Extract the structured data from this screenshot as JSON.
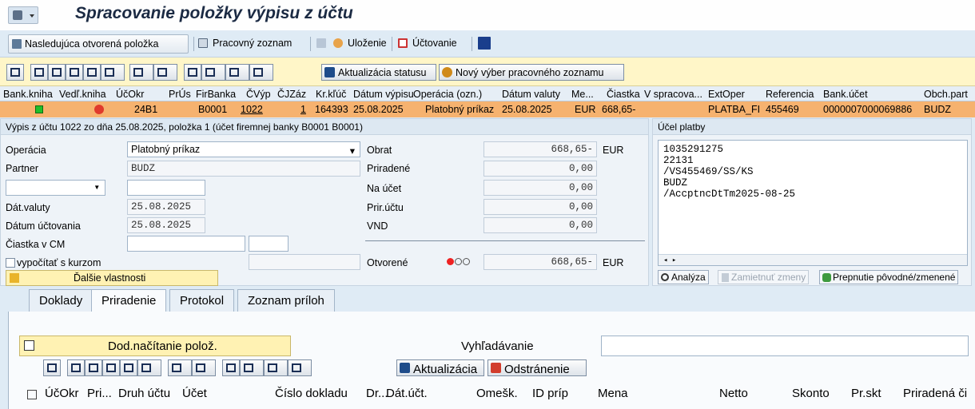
{
  "window": {
    "title": "Spracovanie položky výpisu z účtu"
  },
  "app_toolbar": {
    "next_open_item": "Nasledujúca otvorená položka",
    "worklist": "Pracovný zoznam",
    "save": "Uloženie",
    "posting": "Účtovanie"
  },
  "grid_toolbar": {
    "refresh_status": "Aktualizácia statusu",
    "new_worklist_selection": "Nový výber pracovného zoznamu"
  },
  "grid": {
    "headers": [
      "Bank.kniha",
      "Vedľ.kniha",
      "ÚčOkr",
      "PrÚs",
      "FirBanka",
      "ČVýp",
      "ČJZáz",
      "Kr.kľúč",
      "Dátum výpisu",
      "Operácia (ozn.)",
      "Dátum valuty",
      "Me...",
      "Čiastka",
      "V spracova...",
      "ExtOper",
      "Referencia",
      "Bank.účet",
      "Obch.part"
    ],
    "row": {
      "ucokr": "24B1",
      "firbanka": "B0001",
      "cvyp": "1022",
      "cjzaz": "1",
      "krkluc": "164393",
      "datum_vypisu": "25.08.2025",
      "operacia": "Platobný príkaz",
      "datum_valuty": "25.08.2025",
      "mena": "EUR",
      "ciastka": "668,65-",
      "extoper": "PLATBA_FI",
      "referencia": "455469",
      "bank_ucet": "0000007000069886",
      "obch_part": "BUDZ"
    }
  },
  "detail": {
    "header": "Výpis z účtu 1022 zo dňa 25.08.2025, položka 1 (účet firemnej banky B0001 B0001)",
    "operacia_label": "Operácia",
    "operacia_value": "Platobný príkaz",
    "partner_label": "Partner",
    "partner_value": "BUDZ",
    "dat_valuty_label": "Dát.valuty",
    "dat_valuty_value": "25.08.2025",
    "datum_uctovania_label": "Dátum účtovania",
    "datum_uctovania_value": "25.08.2025",
    "ciastka_cm_label": "Čiastka v CM",
    "vypocitat_label": "vypočítať s kurzom",
    "dalsie_vlastnosti": "Ďalšie vlastnosti",
    "obrat_label": "Obrat",
    "obrat_value": "668,65-",
    "obrat_currency": "EUR",
    "priradene_label": "Priradené",
    "priradene_value": "0,00",
    "na_ucet_label": "Na účet",
    "na_ucet_value": "0,00",
    "pririctu_label": "Prir.účtu",
    "pririctu_value": "0,00",
    "vnd_label": "VND",
    "vnd_value": "0,00",
    "otvorene_label": "Otvorené",
    "otvorene_value": "668,65-",
    "otvorene_currency": "EUR"
  },
  "ucel_platby": {
    "header": "Účel platby",
    "lines": [
      "1035291275",
      "22131",
      "/VS455469/SS/KS",
      "BUDZ",
      "/AccptncDtTm2025-08-25"
    ],
    "analyza": "Analýza",
    "zamietnut": "Zamietnuť zmeny",
    "prepnutie": "Prepnutie pôvodné/zmenené"
  },
  "tabs": [
    "Doklady",
    "Priradenie",
    "Protokol",
    "Zoznam príloh"
  ],
  "lower": {
    "dod_nacitanie": "Dod.načítanie polož.",
    "vyhladavanie": "Vyhľadávanie",
    "refresh": "Aktualizácia",
    "remove": "Odstránenie",
    "columns": [
      "ÚčOkr",
      "Pri...",
      "Druh účtu",
      "Účet",
      "Číslo dokladu",
      "Dr...",
      "Dát.účt.",
      "Omešk.",
      "ID príp",
      "Mena",
      "Netto",
      "Skonto",
      "Pr.skt",
      "Priradená či"
    ]
  }
}
